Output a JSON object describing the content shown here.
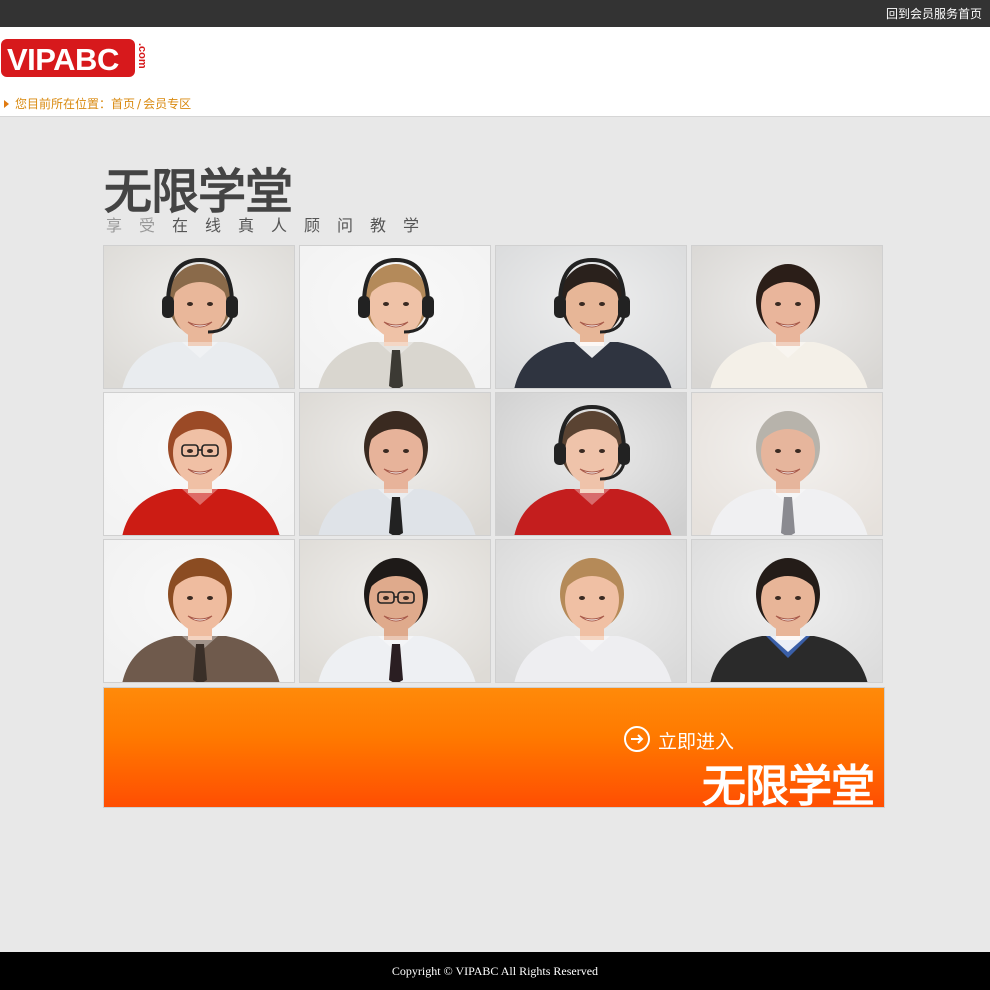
{
  "topbar": {
    "link_label": "回到会员服务首页"
  },
  "logo": {
    "text": "VIPABC",
    "suffix": ".com"
  },
  "breadcrumb": {
    "prefix": "您目前所在位置：",
    "home": "首页",
    "separator": " /",
    "current": "会员专区"
  },
  "hero": {
    "title": "无限学堂",
    "subtitle_light": "享受",
    "subtitle_dark": "在线真人顾问教学"
  },
  "consultants": [
    {
      "alt": "consultant-1",
      "shirt": "#e9ecef",
      "hair": "#8a6a4a",
      "skin": "#e9b79a",
      "headset": true,
      "bg": "#dcdad6"
    },
    {
      "alt": "consultant-2",
      "shirt": "#d9d6cf",
      "hair": "#b48a5a",
      "skin": "#efc2a7",
      "headset": true,
      "tie": "#3c3a34",
      "bg": "#f2f2f2"
    },
    {
      "alt": "consultant-3",
      "shirt": "#2f3440",
      "hair": "#2a211c",
      "skin": "#e7b697",
      "headset": true,
      "bg": "#d9dadb"
    },
    {
      "alt": "consultant-4",
      "shirt": "#f4f0e8",
      "hair": "#2b1e18",
      "skin": "#e9b59b",
      "headset": false,
      "bg": "#d8d6d3"
    },
    {
      "alt": "consultant-5",
      "shirt": "#cc1c14",
      "hair": "#9b4a26",
      "skin": "#f0c0a5",
      "headset": false,
      "glasses": true,
      "bg": "#f3f3f3"
    },
    {
      "alt": "consultant-6",
      "shirt": "#dfe3e8",
      "hair": "#3a2a20",
      "skin": "#e7b39a",
      "headset": false,
      "tie": "#222222",
      "bg": "#dbd8d3"
    },
    {
      "alt": "consultant-7",
      "shirt": "#c41e1e",
      "hair": "#5a4332",
      "skin": "#efc3aa",
      "headset": true,
      "bg": "#cfcfcf"
    },
    {
      "alt": "consultant-8",
      "shirt": "#f0f0f2",
      "hair": "#b7b3ab",
      "skin": "#e6b59c",
      "headset": false,
      "tie": "#8a8a90",
      "bg": "#e6e1dc"
    },
    {
      "alt": "consultant-9",
      "shirt": "#6f5a4c",
      "hair": "#8b4c22",
      "skin": "#efbc9f",
      "headset": false,
      "tie": "#3a2f28",
      "bg": "#f1f1f1"
    },
    {
      "alt": "consultant-10",
      "shirt": "#eef0f3",
      "hair": "#1e1a18",
      "skin": "#dfaa8c",
      "headset": false,
      "tie": "#2a1e22",
      "glasses": true,
      "bg": "#dedbd6"
    },
    {
      "alt": "consultant-11",
      "shirt": "#eeeef1",
      "hair": "#b58a58",
      "skin": "#f0c0a4",
      "headset": false,
      "bg": "#d9d9d9"
    },
    {
      "alt": "consultant-12",
      "shirt": "#2a2a2a",
      "hair": "#241c18",
      "skin": "#e8b598",
      "headset": false,
      "collar": "#3a5fa8",
      "bg": "#dcdcdc"
    }
  ],
  "enter_banner": {
    "label": "立即进入",
    "title": "无限学堂",
    "color": "#ff6a00"
  },
  "footer": {
    "copyright": "Copyright © VIPABC All Rights Reserved"
  }
}
